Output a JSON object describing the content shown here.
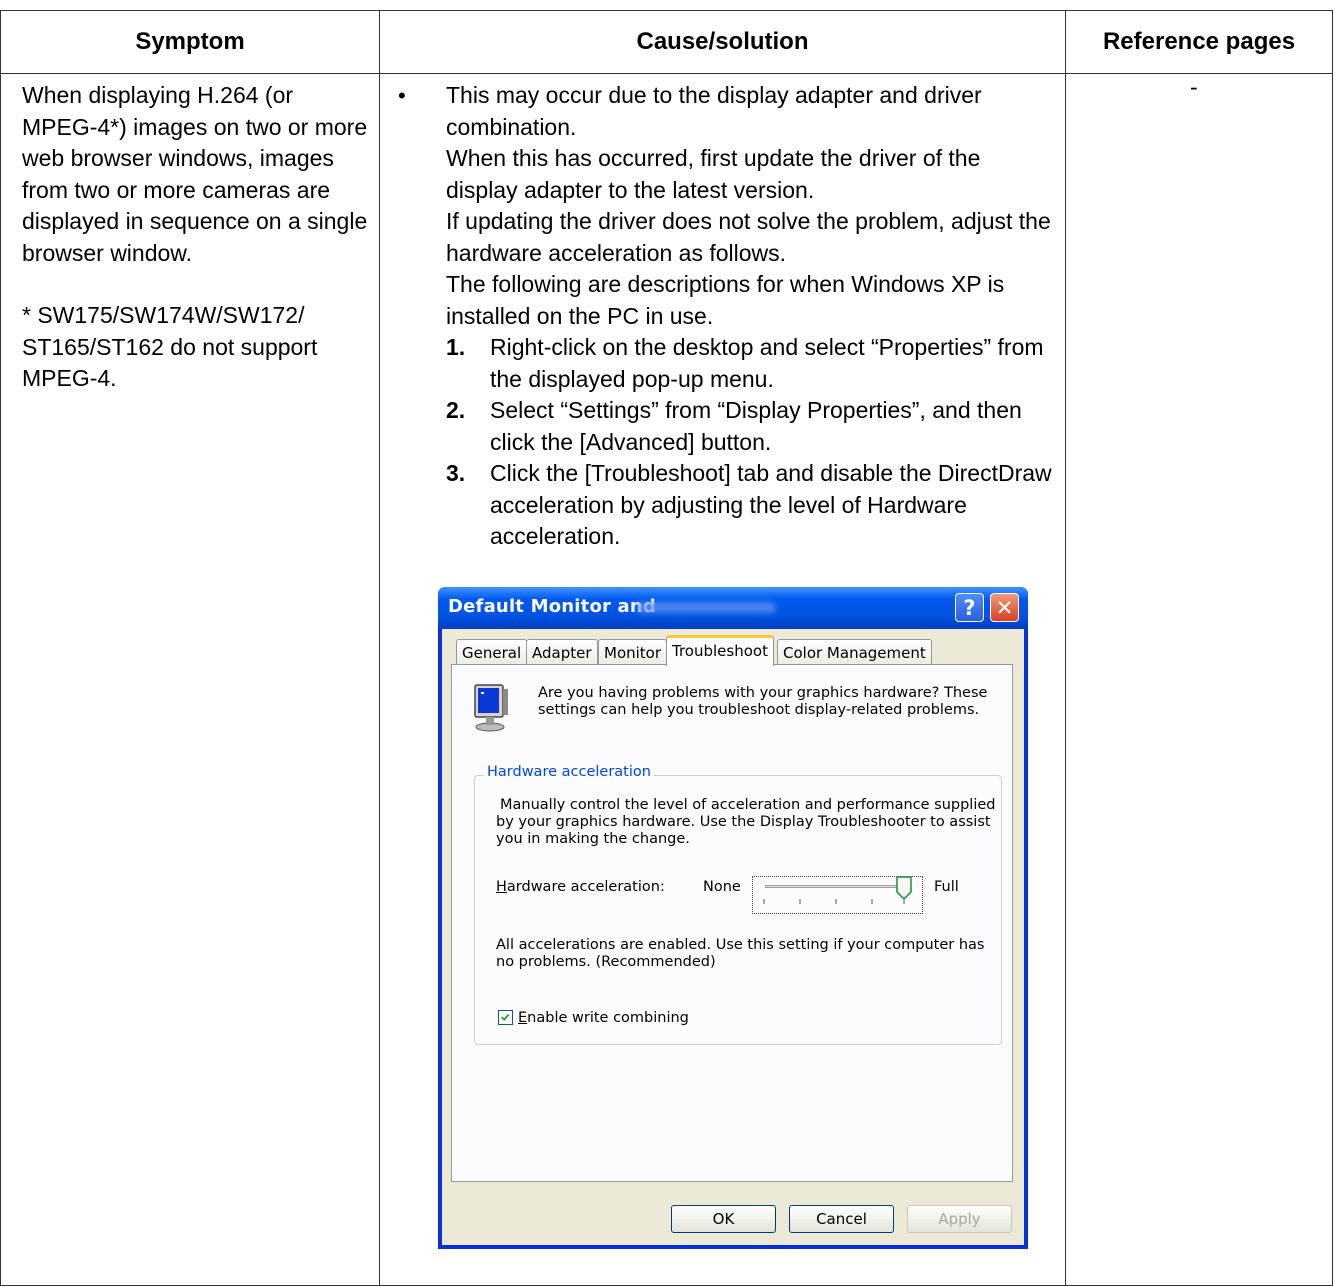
{
  "table": {
    "headers": [
      "Symptom",
      "Cause/solution",
      "Reference pages"
    ],
    "symptom_main": "When displaying H.264 (or MPEG-4*) images on two or more web browser windows, images from two or more cameras are displayed in sequence on a single browser window.",
    "symptom_note": "* SW175/SW174W/SW172/ ST165/ST162 do not support MPEG-4.",
    "bullet": "•",
    "cause_intro": [
      "This may occur due to the display adapter and driver combination.",
      "When this has occurred, first update the driver of the display adapter to the latest version.",
      "If updating the driver does not solve the problem, adjust the hardware acceleration as follows.",
      "The following are descriptions for when Windows XP is installed on the PC in use."
    ],
    "steps": [
      {
        "num": "1.",
        "text": "Right-click on the desktop and select “Properties” from the displayed pop-up menu."
      },
      {
        "num": "2.",
        "text": "Select “Settings” from “Display Properties”, and then click the [Advanced] button."
      },
      {
        "num": "3.",
        "text": "Click the [Troubleshoot] tab and disable the DirectDraw acceleration by adjusting the level of Hardware acceleration."
      }
    ],
    "reference": "-"
  },
  "dialog": {
    "title": "Default Monitor and",
    "help_glyph": "?",
    "close_glyph": "✕",
    "tabs": [
      "General",
      "Adapter",
      "Monitor",
      "Troubleshoot",
      "Color Management"
    ],
    "active_tab": "Troubleshoot",
    "intro": "Are you having problems with your graphics hardware? These settings can help you troubleshoot display-related problems.",
    "group_label": "Hardware acceleration",
    "group_desc": "Manually control the level of acceleration and performance supplied by your graphics hardware. Use the Display Troubleshooter to assist you in making the change.",
    "slider_label_accel": "H",
    "slider_label_rest": "ardware acceleration:",
    "slider_min": "None",
    "slider_max": "Full",
    "slider_level": 1.0,
    "status_text": "All accelerations are enabled. Use this setting if your computer has no problems. (Recommended)",
    "checkbox_accel": "E",
    "checkbox_rest": "nable write combining",
    "checkbox_checked": true,
    "buttons": {
      "ok": "OK",
      "cancel": "Cancel",
      "apply": "Apply"
    },
    "colors": {
      "titlebar": "#0058ee",
      "face": "#ece9d8",
      "group_label": "#0046d5"
    }
  }
}
